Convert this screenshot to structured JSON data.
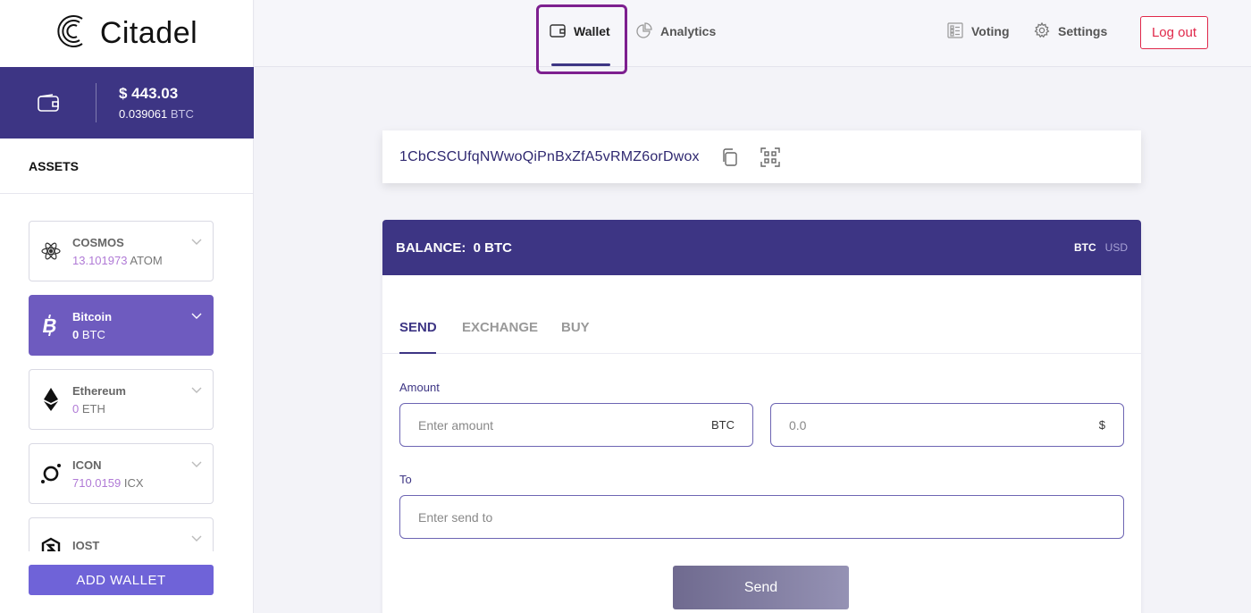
{
  "app": {
    "name": "Citadel"
  },
  "wallet_summary": {
    "usd": "$ 443.03",
    "btc_amount": "0.039061",
    "btc_unit": "BTC"
  },
  "assets": {
    "title": "ASSETS",
    "items": [
      {
        "name": "COSMOS",
        "amount": "13.101973",
        "unit": "ATOM",
        "active": false
      },
      {
        "name": "Bitcoin",
        "amount": "0",
        "unit": "BTC",
        "active": true
      },
      {
        "name": "Ethereum",
        "amount": "0",
        "unit": "ETH",
        "active": false
      },
      {
        "name": "ICON",
        "amount": "710.0159",
        "unit": "ICX",
        "active": false
      },
      {
        "name": "IOST",
        "amount": "",
        "unit": "",
        "active": false
      }
    ],
    "add_label": "ADD WALLET"
  },
  "nav": {
    "wallet": "Wallet",
    "analytics": "Analytics",
    "voting": "Voting",
    "settings": "Settings",
    "logout": "Log out"
  },
  "address": "1CbCSCUfqNWwoQiPnBxZfA5vRMZ6orDwox",
  "balance": {
    "label": "BALANCE:",
    "value": "0 BTC",
    "unit_btc": "BTC",
    "unit_usd": "USD"
  },
  "tabs": {
    "send": "SEND",
    "exchange": "EXCHANGE",
    "buy": "BUY"
  },
  "form": {
    "amount_label": "Amount",
    "amount_placeholder": "Enter amount",
    "amount_unit": "BTC",
    "usd_placeholder": "0.0",
    "usd_unit": "$",
    "to_label": "To",
    "to_placeholder": "Enter send to",
    "send_label": "Send"
  },
  "colors": {
    "primary": "#3d3584",
    "accent": "#6e5bbf",
    "add_button": "#6f63d8",
    "logout": "#e0284a",
    "highlight": "#7d1f8f"
  }
}
